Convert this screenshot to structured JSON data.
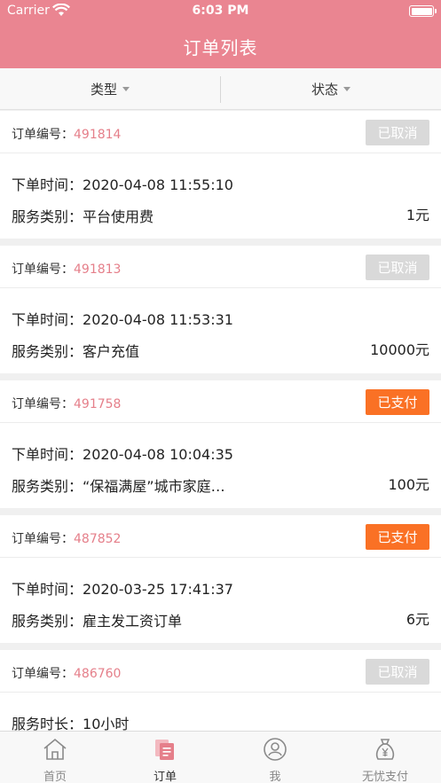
{
  "status_bar": {
    "carrier": "Carrier",
    "time": "6:03 PM"
  },
  "header": {
    "title": "订单列表"
  },
  "filters": [
    {
      "label": "类型"
    },
    {
      "label": "状态"
    }
  ],
  "orders": [
    {
      "order_label": "订单编号：",
      "order_no": "491814",
      "status": "已取消",
      "line1_label": "下单时间：",
      "line1_value": "2020-04-08 11:55:10",
      "line2_label": "服务类别：",
      "line2_value": "平台使用费",
      "amount": "1元"
    },
    {
      "order_label": "订单编号：",
      "order_no": "491813",
      "status": "已取消",
      "line1_label": "下单时间：",
      "line1_value": "2020-04-08 11:53:31",
      "line2_label": "服务类别：",
      "line2_value": "客户充值",
      "amount": "10000元"
    },
    {
      "order_label": "订单编号：",
      "order_no": "491758",
      "status": "已支付",
      "line1_label": "下单时间：",
      "line1_value": "2020-04-08 10:04:35",
      "line2_label": "服务类别：",
      "line2_value": "“保福满屋”城市家庭…",
      "amount": "100元"
    },
    {
      "order_label": "订单编号：",
      "order_no": "487852",
      "status": "已支付",
      "line1_label": "下单时间：",
      "line1_value": "2020-03-25 17:41:37",
      "line2_label": "服务类别：",
      "line2_value": "雇主发工资订单",
      "amount": "6元"
    },
    {
      "order_label": "订单编号：",
      "order_no": "486760",
      "status": "已取消",
      "line1_label": "服务时长：",
      "line1_value": "10小时"
    }
  ],
  "tabs": [
    {
      "label": "首页",
      "icon": "home-icon"
    },
    {
      "label": "订单",
      "icon": "orders-icon"
    },
    {
      "label": "我",
      "icon": "profile-icon"
    },
    {
      "label": "无忧支付",
      "icon": "money-bag-icon"
    }
  ],
  "colors": {
    "header": "#ea8591",
    "paid": "#fa7125",
    "cancelled": "#d9d9d9",
    "order_no": "#e57f8a",
    "active_tab": "#e57f8a"
  }
}
